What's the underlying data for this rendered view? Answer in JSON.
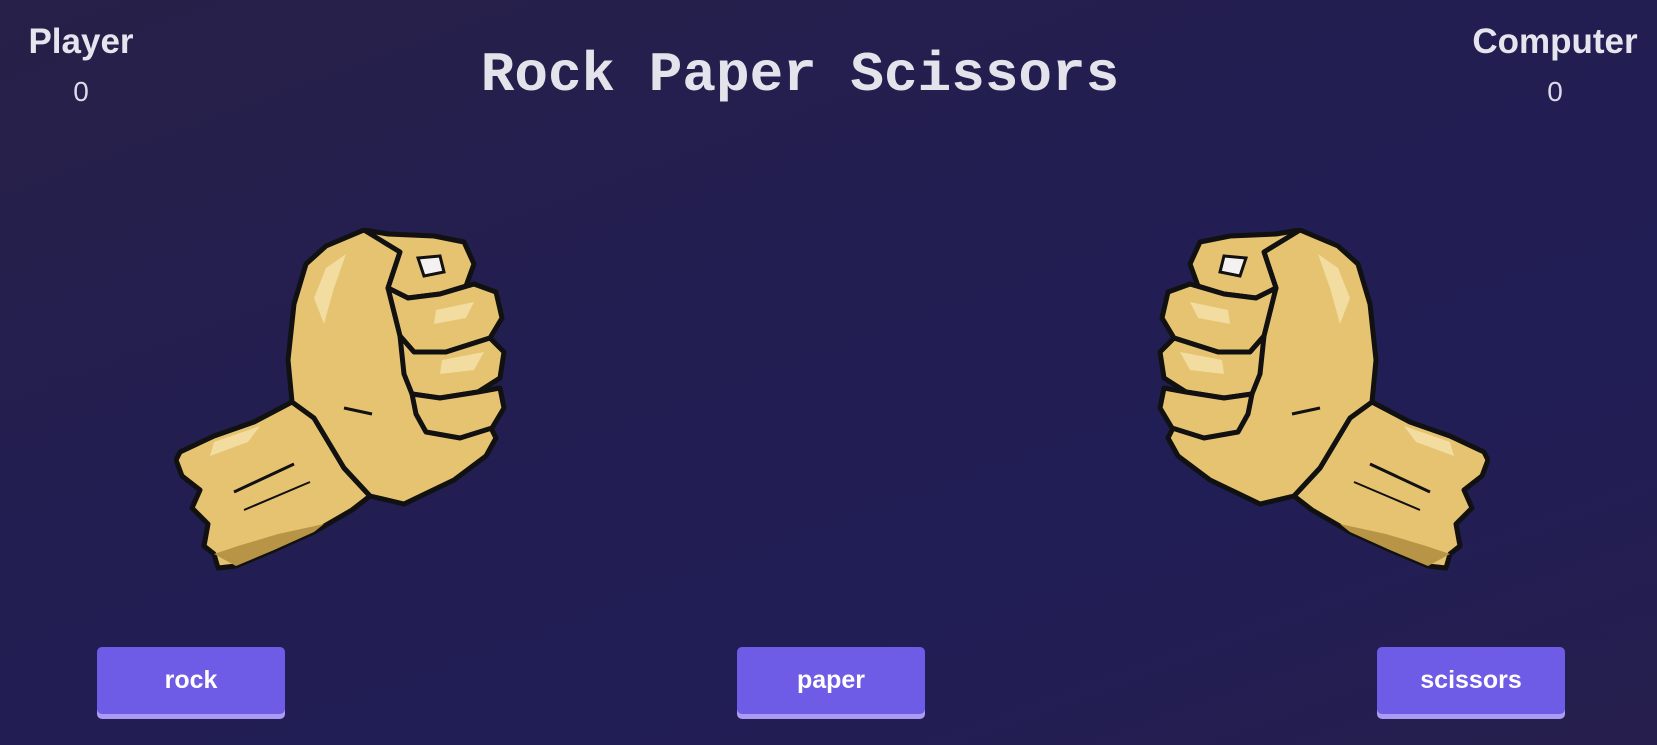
{
  "scoreboard": {
    "player": {
      "label": "Player",
      "score": "0"
    },
    "computer": {
      "label": "Computer",
      "score": "0"
    }
  },
  "title": "Rock Paper Scissors",
  "hands": {
    "player": {
      "icon": "fist-icon",
      "choice": "rock"
    },
    "computer": {
      "icon": "fist-icon",
      "choice": "rock"
    }
  },
  "buttons": {
    "rock": "rock",
    "paper": "paper",
    "scissors": "scissors"
  },
  "colors": {
    "background": "#221e52",
    "button": "#6e5ce6",
    "button_shadow": "#a99cf2",
    "skin": "#e6c371",
    "outline": "#111111",
    "text": "#e6e4ec"
  }
}
